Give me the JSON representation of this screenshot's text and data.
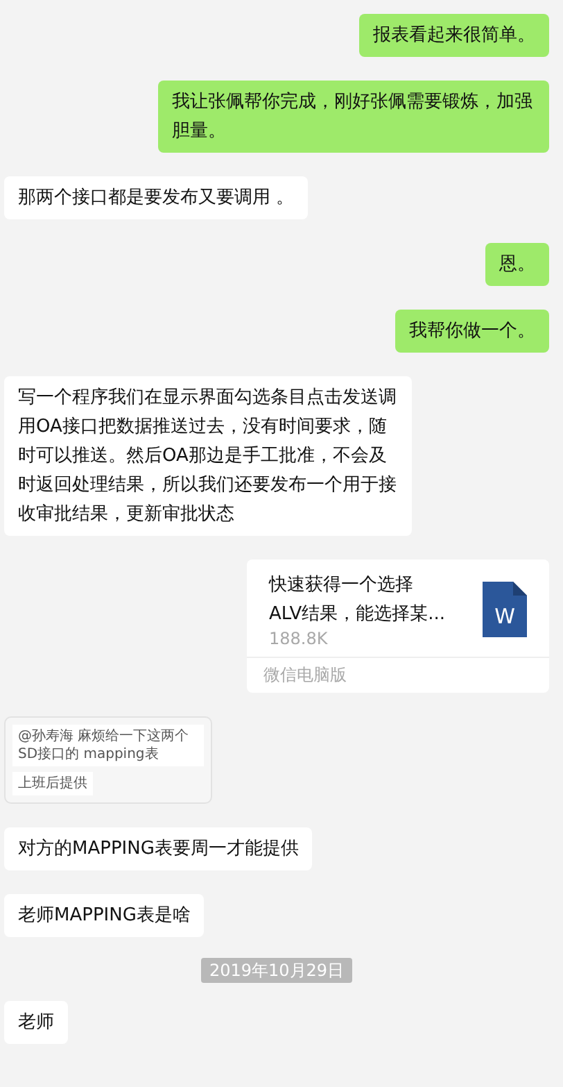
{
  "messages": [
    {
      "kind": "text",
      "outgoing": true,
      "text": "报表看起来很简单。"
    },
    {
      "kind": "text",
      "outgoing": true,
      "text": "我让张佩帮你完成，刚好张佩需要锻炼，加强胆量。"
    },
    {
      "kind": "text",
      "outgoing": false,
      "text": "那两个接口都是要发布又要调用 。"
    },
    {
      "kind": "text",
      "outgoing": true,
      "text": "恩。"
    },
    {
      "kind": "text",
      "outgoing": true,
      "text": "我帮你做一个。"
    },
    {
      "kind": "text",
      "outgoing": false,
      "text": "写一个程序我们在显示界面勾选条目点击发送调用OA接口把数据推送过去，没有时间要求，随时可以推送。然后OA那边是手工批准，不会及时返回处理结果，所以我们还要发布一个用于接收审批结果，更新审批状态"
    },
    {
      "kind": "file",
      "title_lines": [
        "快速获得一个选择",
        "ALV结果，能选择某..."
      ],
      "size": "188.8K",
      "icon_letter": "W",
      "source": "微信电脑版"
    },
    {
      "kind": "image",
      "quote": "@孙寿海 麻烦给一下这两个SD接口的 mapping表",
      "reply": "上班后提供"
    },
    {
      "kind": "text",
      "outgoing": false,
      "text": "对方的MAPPING表要周一才能提供"
    },
    {
      "kind": "text",
      "outgoing": false,
      "text": "老师MAPPING表是啥"
    },
    {
      "kind": "date",
      "text": "2019年10月29日"
    },
    {
      "kind": "text",
      "outgoing": false,
      "text": "老师"
    }
  ]
}
